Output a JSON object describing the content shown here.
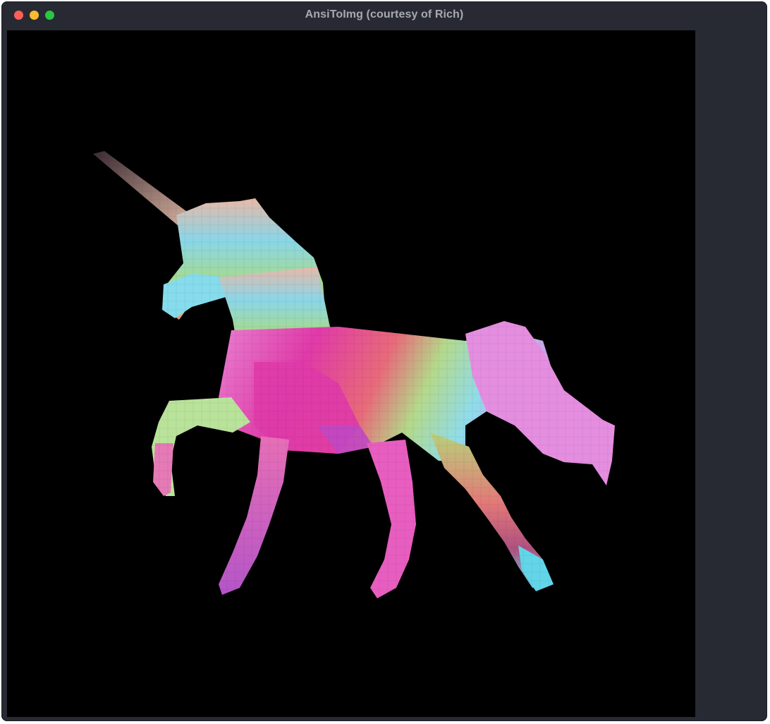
{
  "window": {
    "title": "AnsiToImg (courtesy of Rich)",
    "controls": {
      "close_color": "#ff5f57",
      "minimize_color": "#febc2e",
      "maximize_color": "#28c840"
    }
  },
  "terminal": {
    "background": "#000000",
    "content": "pixelated-rainbow-unicorn-image"
  }
}
